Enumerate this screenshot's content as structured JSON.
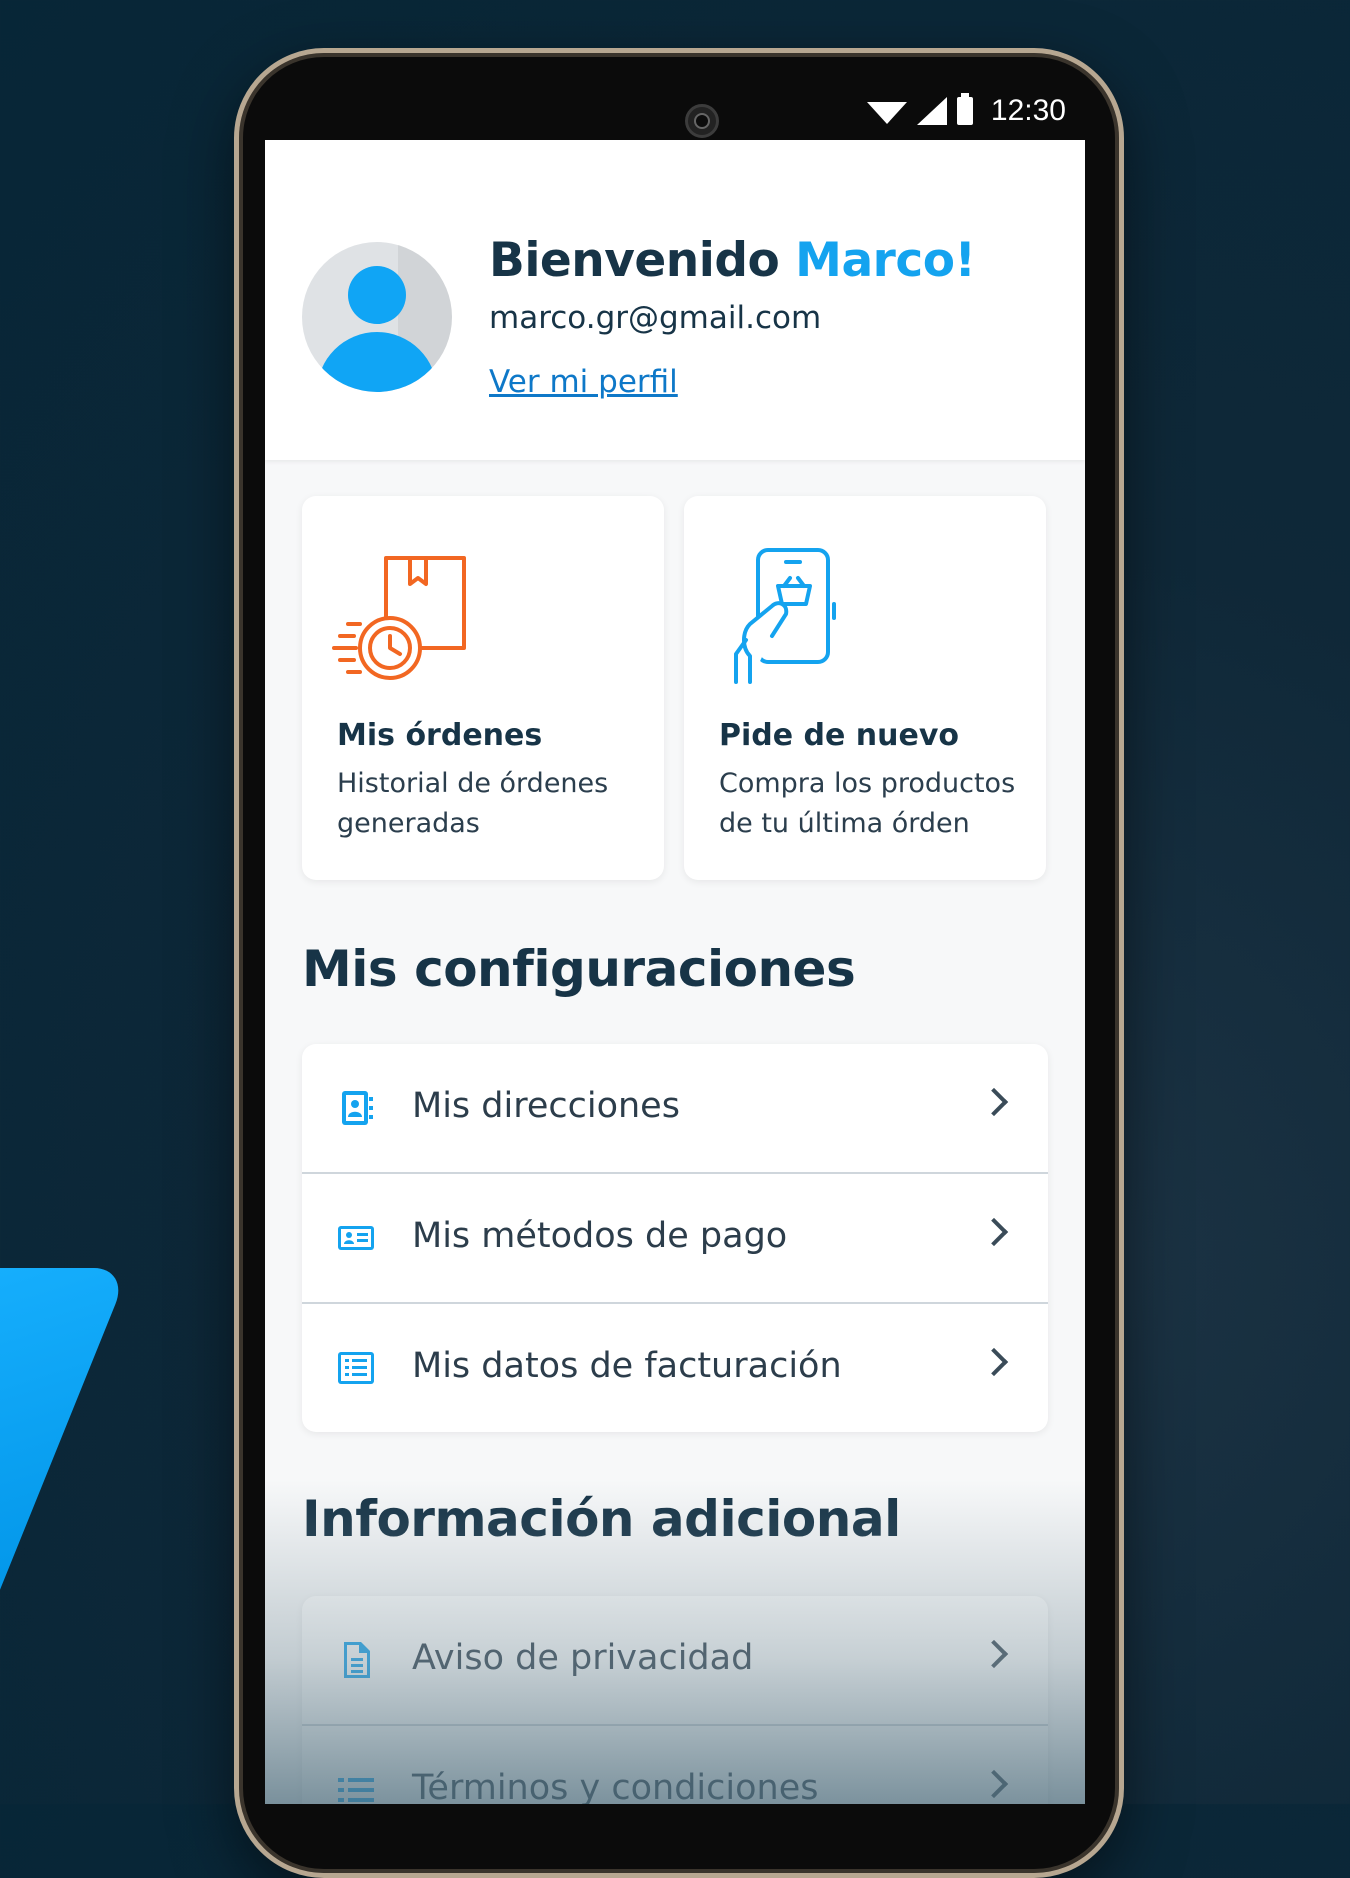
{
  "status_bar": {
    "time": "12:30"
  },
  "profile": {
    "greeting": "Bienvenido",
    "name": "Marco!",
    "email": "marco.gr@gmail.com",
    "link": "Ver mi perfil"
  },
  "cards": [
    {
      "title": "Mis órdenes",
      "description": "Historial de órdenes generadas",
      "icon": "delivery-box-clock-icon"
    },
    {
      "title": "Pide de nuevo",
      "description": "Compra los productos de tu última órden",
      "icon": "phone-basket-icon"
    }
  ],
  "settings": {
    "title": "Mis configuraciones",
    "items": [
      {
        "label": "Mis direcciones",
        "icon": "address-book-icon"
      },
      {
        "label": "Mis métodos de pago",
        "icon": "payment-card-icon"
      },
      {
        "label": "Mis datos de facturación",
        "icon": "billing-list-icon"
      }
    ]
  },
  "additional": {
    "title": "Información adicional",
    "items": [
      {
        "label": "Aviso de privacidad",
        "icon": "document-icon"
      },
      {
        "label": "Términos y condiciones",
        "icon": "list-icon"
      }
    ]
  },
  "colors": {
    "accent": "#14a3ef",
    "text": "#173447",
    "orange": "#f26722",
    "background": "#072637"
  }
}
